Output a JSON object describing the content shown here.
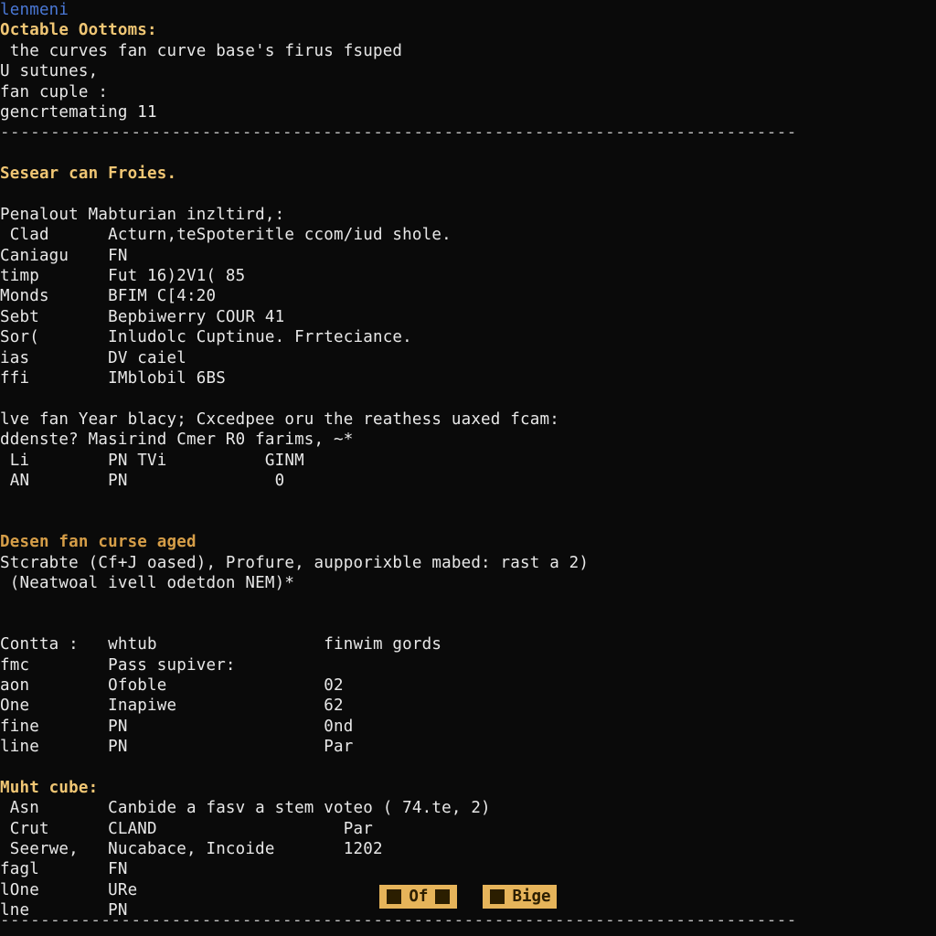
{
  "header": {
    "title": "lenmeni",
    "heading1": "Octable Oottoms:",
    "line1": " the curves fan curve base's firus fsuped",
    "line2": "U sutunes,",
    "line3": "fan cuple :",
    "line4": "gencrtemating 11"
  },
  "hr": "-------------------------------------------------------------------------------",
  "section1": {
    "title": "Sesear can Froies.",
    "line_pre": "Penalout Mabturian inzltird,:",
    "rows": [
      {
        "k": " Clad",
        "v": "Acturn,teSpoteritle ccom/iud shole."
      },
      {
        "k": "Caniagu",
        "v": "FN"
      },
      {
        "k": "timp",
        "v": "Fut 16)2V1( 85"
      },
      {
        "k": "Monds",
        "v": "BFIM C[4:20"
      },
      {
        "k": "Sebt",
        "v": "Bepbiwerry COUR 41"
      },
      {
        "k": "Sor(",
        "v": "Inludolc Cuptinue. Frrteciance."
      },
      {
        "k": "ias",
        "v": "DV caiel"
      },
      {
        "k": "ffi",
        "v": "IMblobil 6BS"
      }
    ],
    "line_a": "lve fan Year blacy; Cxcedpee oru the reathess uaxed fcam:",
    "line_b": "ddenste? Masirind Cmer R0 farims, ~*",
    "mini": [
      {
        "c1": " Li",
        "c2": "PN TVi",
        "c3": "GINM"
      },
      {
        "c1": " AN",
        "c2": "PN",
        "c3": " 0"
      }
    ]
  },
  "section2": {
    "title": "Desen fan curse aged",
    "line1": "Stcrabte (Cf+J oased), Profure, aupporixble mabed: rast a 2)",
    "line2": " (Neatwoal ivell odetdon NEM)*",
    "rows1": [
      {
        "c1": "Contta :",
        "c2": "whtub",
        "c3": "finwim gords"
      },
      {
        "c1": "fmc",
        "c2": "Pass supiver:",
        "c3": ""
      },
      {
        "c1": "aon",
        "c2": "Ofoble",
        "c3": "02"
      },
      {
        "c1": "One",
        "c2": "Inapiwe",
        "c3": "62"
      },
      {
        "c1": "fine",
        "c2": "PN",
        "c3": "0nd"
      },
      {
        "c1": "line",
        "c2": "PN",
        "c3": "Par"
      }
    ],
    "subhead": "Muht cube:",
    "rows2": [
      {
        "c1": " Asn",
        "c2": "Canbide a fasv a stem voteo ( 74.te, 2)",
        "c3": ""
      },
      {
        "c1": " Crut",
        "c2": "CLAND",
        "c3": "Par"
      },
      {
        "c1": " Seerwe,",
        "c2": "Nucabace, Incoide",
        "c3": "1202"
      },
      {
        "c1": "fagl",
        "c2": "FN",
        "c3": ""
      },
      {
        "c1": "lOne",
        "c2": "URe",
        "c3": ""
      },
      {
        "c1": "lne",
        "c2": "PN",
        "c3": ""
      }
    ]
  },
  "buttons": {
    "left": "Of",
    "right": "Bige"
  }
}
